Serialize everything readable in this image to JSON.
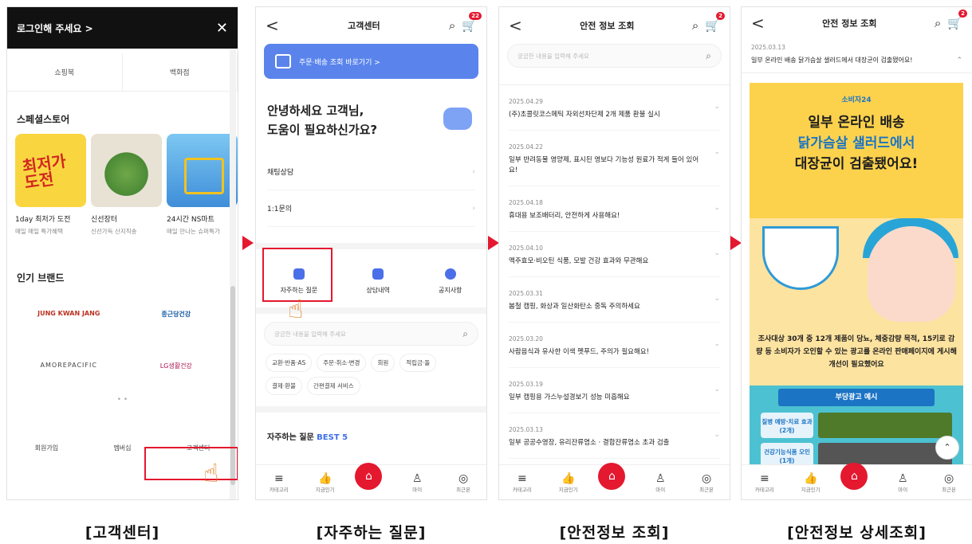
{
  "panel1": {
    "header": "로그인해 주세요 >",
    "close": "✕",
    "tabs": [
      "쇼핑북",
      "백화점"
    ],
    "special_title": "스페셜스토어",
    "special_cards": [
      {
        "thumb_text": "최저가 도전",
        "name": "1day 최저가 도전",
        "sub": "매일 매일 특가혜택"
      },
      {
        "name": "신선장터",
        "sub": "신선가득 산지직송"
      },
      {
        "name": "24시간 NS마트",
        "sub": "매일 만나는 슈퍼특가"
      }
    ],
    "brands_title": "인기 브랜드",
    "brands": [
      "JUNG KWAN JANG",
      "종근당건강",
      "AMOREPACIFIC",
      "LG생활건강"
    ],
    "dots": "• •",
    "bottom_links": [
      "회원가입",
      "멤버십",
      "고객센터"
    ]
  },
  "panel2": {
    "back": "<",
    "title": "고객센터",
    "cart_badge": "22",
    "banner": "주문·배송 조회 바로가기 >",
    "greeting_line1": "안녕하세요 고객님,",
    "greeting_line2": "도움이 필요하신가요?",
    "menu": [
      "채팅상담",
      "1:1문의"
    ],
    "quick": [
      "자주하는 질문",
      "상담내역",
      "공지사항"
    ],
    "search_placeholder": "궁금한 내용을 입력해 주세요",
    "chips": [
      "교환·반품·AS",
      "주문·취소·변경",
      "회원",
      "적립금·돌",
      "결제·환불",
      "간편결제 서비스"
    ],
    "best_prefix": "자주하는 질문 ",
    "best_highlight": "BEST 5"
  },
  "panel3": {
    "title": "안전 정보 조회",
    "cart_badge": "2",
    "search_placeholder": "궁금한 내용을 입력해 주세요",
    "items": [
      {
        "date": "2025.04.29",
        "text": "(주)초콜릿코스메틱 자외선차단제 2개 제품 환불 실시"
      },
      {
        "date": "2025.04.22",
        "text": "일부 반려동물 영양제, 표시된 영보다 기능성 원료가 적게 들어 있어요!"
      },
      {
        "date": "2025.04.18",
        "text": "휴대용 보조배터리, 안전하게 사용해요!"
      },
      {
        "date": "2025.04.10",
        "text": "맥주효모·비오틴 식품, 모발 건강 효과와 무관해요"
      },
      {
        "date": "2025.03.31",
        "text": "봄철 캠핑, 화상과 일산화탄소 중독 주의하세요"
      },
      {
        "date": "2025.03.20",
        "text": "사람음식과 유사한 이색 펫푸드, 주의가 필요해요!"
      },
      {
        "date": "2025.03.19",
        "text": "일부 캠핑용 가스누설경보기 성능 미흡해요"
      },
      {
        "date": "2025.03.13",
        "text": "일부 공공수영장, 유리잔류염소 · 결합잔류염소 초과 검출"
      }
    ]
  },
  "panel4": {
    "title": "안전 정보 조회",
    "cart_badge": "2",
    "date": "2025.03.13",
    "headline": "일부 온라인 배송 닭가슴살 샐러드에서 대장균이 검출됐어요!",
    "poster_logo": "소비자24",
    "poster_line1": "일부 온라인 배송",
    "poster_line2": "닭가슴살 샐러드에서",
    "poster_line3": "대장균이 검출됐어요!",
    "poster_body": "조사대상 30개 중 12개 제품이 당뇨, 체중감량 목적, 15키로 감량 등 소비자가 오인할 수 있는 광고를 온라인 판매페이지에 게시해 개선이 필요했어요",
    "ad_title": "부당광고 예시",
    "ad_labels": [
      "질병 예방·치료 효과(2개)",
      "건강기능식품 오인(1개)"
    ]
  },
  "bottom_nav": [
    "카테고리",
    "지금인기",
    "홈",
    "마이",
    "최근본"
  ],
  "captions": [
    "[고객센터]",
    "[자주하는 질문]",
    "[안전정보 조회]",
    "[안전정보 상세조회]"
  ]
}
